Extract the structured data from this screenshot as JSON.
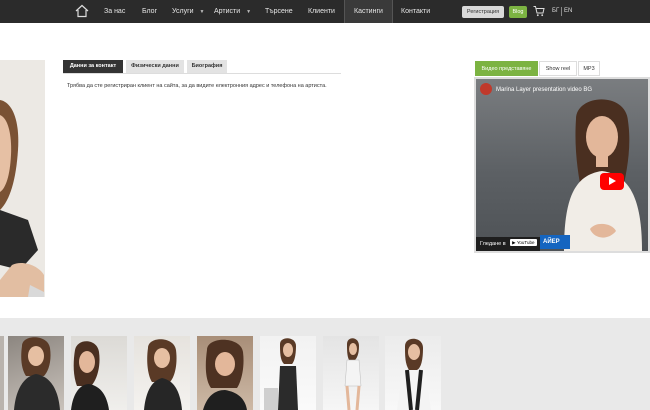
{
  "nav": {
    "items": [
      {
        "label": "За нас"
      },
      {
        "label": "Блог"
      },
      {
        "label": "Услуги",
        "has_dropdown": true
      },
      {
        "label": "Артисти",
        "has_dropdown": true
      },
      {
        "label": "Търсене"
      },
      {
        "label": "Клиенти"
      },
      {
        "label": "Кастинги",
        "active": true
      },
      {
        "label": "Контакти"
      }
    ],
    "register_label": "Регистрация",
    "blog_label": "Blog",
    "lang_bg": "БГ",
    "lang_en": "EN"
  },
  "profile": {
    "tabs": [
      {
        "label": "Данни за контакт",
        "active": true
      },
      {
        "label": "Физически данни"
      },
      {
        "label": "Биография"
      }
    ],
    "contact_text": "Трябва да сте регистриран клиент на сайта, за да видите електронния адрес и телефона на артиста."
  },
  "video_panel": {
    "tabs": [
      {
        "label": "Видео представяне",
        "active": true
      },
      {
        "label": "Show reel"
      },
      {
        "label": "MP3"
      }
    ],
    "video_title": "Marina Layer presentation video BG",
    "watch_on": "Гледане в",
    "youtube": "YouTube",
    "overlay_text": "АЙЕР"
  },
  "gallery": {
    "count": 7
  },
  "colors": {
    "topbar": "#2b2b2b",
    "accent_green": "#7cb342",
    "tab_active": "#333333",
    "youtube_red": "#ff0000"
  }
}
